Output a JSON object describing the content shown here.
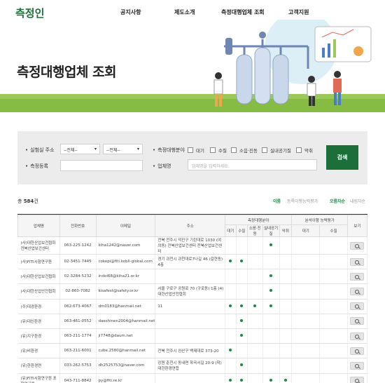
{
  "header": {
    "logo": "측정인",
    "nav": [
      "공지사항",
      "제도소개",
      "측정대행업체 조회",
      "고객지원"
    ]
  },
  "hero": {
    "title": "측정대행업체 조회"
  },
  "search": {
    "address_label": "실험실 주소",
    "address_select1": "--전체--",
    "address_select2": "--전체--",
    "field_label": "측정대행분야",
    "fields": [
      "대기",
      "수질",
      "소음·진동",
      "실내공기질",
      "악취"
    ],
    "reg_label": "측정등록",
    "company_label": "업체명",
    "company_placeholder": "업체명을 입력하세요.",
    "search_button": "검색"
  },
  "results": {
    "total_prefix": "총",
    "total_count": "584",
    "total_suffix": "건",
    "sort_options": [
      "이름",
      "등록이행능력평가",
      "오름차순",
      "내림차순"
    ]
  },
  "table": {
    "headers": {
      "company": "업체명",
      "phone": "전화번호",
      "email": "이메일",
      "address": "주소",
      "field_group": "측정대행분야",
      "eval_group": "분석이행 능력평가",
      "view": "보기"
    },
    "sub_headers": [
      "대기",
      "수질",
      "소음·진동",
      "실내공기질",
      "악취",
      "대기",
      "수질"
    ],
    "rows": [
      {
        "name": "(사)대한산업보건협회 전북산업보건센터",
        "phone": "063-225-1242",
        "email": "kiha1242@naver.com",
        "address": "전북 전주시 덕진구 기린대로 1030 (여의동) 전북산업보건센터 전북산업보건센터",
        "marks": [
          0,
          0,
          0,
          1,
          0,
          0,
          0
        ]
      },
      {
        "name": "(사)FITI시험연구원",
        "phone": "02-3451-7445",
        "email": "cokepi@fiti.kobli-global.com",
        "address": "경기 과천시 과천대로7나길 46 (갈현동) 4층",
        "marks": [
          1,
          1,
          0,
          0,
          0,
          0,
          0
        ]
      },
      {
        "name": "(사)대한산업보건협회",
        "phone": "02-3284-5232",
        "email": "indoi68@kiha21.or.kr",
        "address": "",
        "marks": [
          0,
          0,
          0,
          1,
          0,
          0,
          0
        ]
      },
      {
        "name": "(사)대한산업안전협회",
        "phone": "02-860-7082",
        "email": "kisafest@safety.or.kr",
        "address": "서울 구로구 공원로 70 (구로동) 1층 (4) 대한산업안전협회",
        "marks": [
          0,
          0,
          0,
          1,
          0,
          0,
          0
        ]
      },
      {
        "name": "(주)대경환경",
        "phone": "062-673-4067",
        "email": "dm0183@hanmail.net",
        "address": "11",
        "marks": [
          1,
          1,
          1,
          1,
          0,
          0,
          0
        ]
      },
      {
        "name": "(유)대신환경",
        "phone": "063-461-0552",
        "email": "daeshinen2004@hanmail.net",
        "address": "",
        "marks": [
          0,
          1,
          0,
          0,
          0,
          0,
          0
        ]
      },
      {
        "name": "(유)지구환경",
        "phone": "063-211-1774",
        "email": "ji7748@daum.net",
        "address": "",
        "marks": [
          0,
          1,
          0,
          0,
          0,
          0,
          0
        ]
      },
      {
        "name": "(유)비환경",
        "phone": "063-211-6001",
        "email": "cube.2580@hanmail.net",
        "address": "전북 전주시 완산구 백제대로 373-20",
        "marks": [
          1,
          0,
          0,
          0,
          0,
          0,
          0
        ]
      },
      {
        "name": "(유)한환경연",
        "phone": "033-262-5753",
        "email": "dh2525753@naver.com",
        "address": "강원 춘천시 동내면 학곡서길 20-9 (학) 대한환경연합",
        "marks": [
          0,
          1,
          0,
          0,
          0,
          0,
          0
        ]
      },
      {
        "name": "(유)FITI시험연구원 포항연구원",
        "phone": "043-711-8842",
        "email": "py@fiti.re.kr",
        "address": "",
        "marks": [
          1,
          1,
          0,
          1,
          1,
          0,
          0
        ]
      }
    ]
  },
  "colors": {
    "brand": "#1d6f3a",
    "dot": "#1d8a45",
    "grass": "#9bc95a"
  }
}
